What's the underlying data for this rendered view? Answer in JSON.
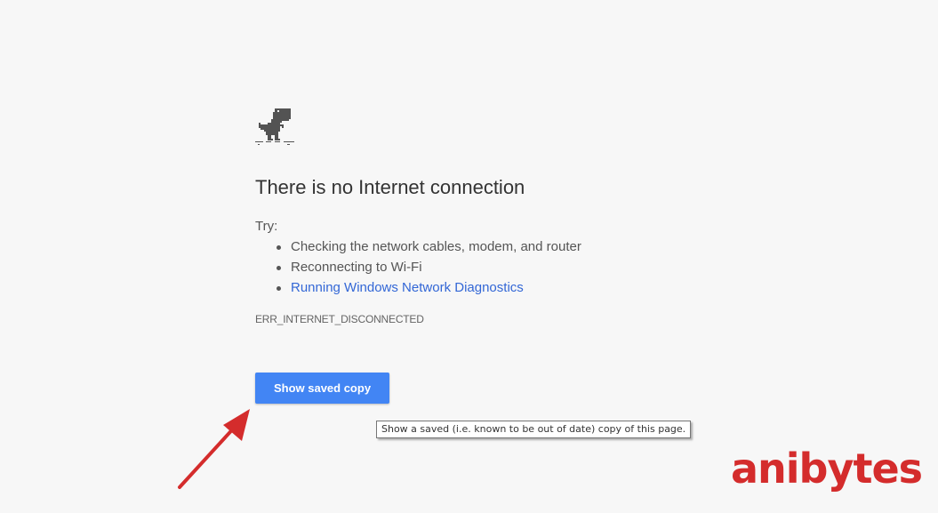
{
  "page": {
    "title": "There is no Internet connection",
    "try_label": "Try:",
    "suggestions": [
      "Checking the network cables, modem, and router",
      "Reconnecting to Wi-Fi",
      "Running Windows Network Diagnostics"
    ],
    "error_code": "ERR_INTERNET_DISCONNECTED",
    "dino_icon": "offline-dino-icon"
  },
  "button": {
    "label": "Show saved copy",
    "tooltip": "Show a saved (i.e. known to be out of date) copy of this page."
  },
  "watermark": {
    "text": "anibytes",
    "color": "#d42c2c"
  },
  "colors": {
    "background": "#f7f7f7",
    "text": "#333333",
    "link": "#3367d6",
    "button": "#4285f4",
    "annotation_arrow": "#d42c2c"
  }
}
